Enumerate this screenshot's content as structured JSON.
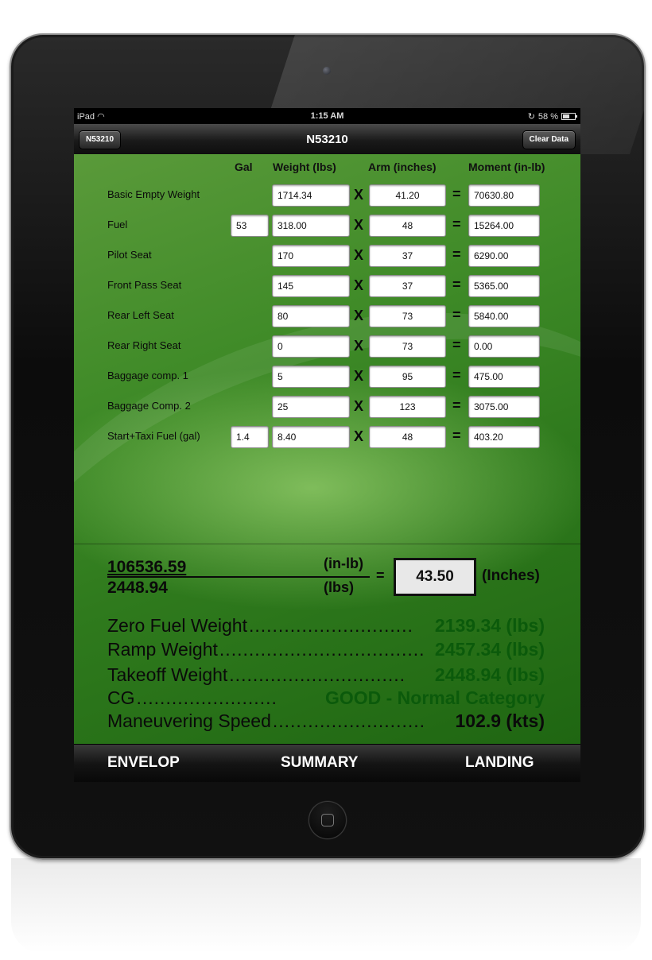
{
  "status_bar": {
    "carrier": "iPad",
    "time": "1:15 AM",
    "battery": "58 %"
  },
  "nav": {
    "back_label": "N53210",
    "title": "N53210",
    "clear_label": "Clear Data"
  },
  "columns": {
    "gal": "Gal",
    "weight": "Weight (lbs)",
    "arm": "Arm (inches)",
    "moment": "Moment (in-lb)"
  },
  "operators": {
    "times": "X",
    "equals": "="
  },
  "rows": [
    {
      "label": "Basic Empty Weight",
      "gal": null,
      "weight": "1714.34",
      "arm": "41.20",
      "moment": "70630.80"
    },
    {
      "label": "Fuel",
      "gal": "53",
      "weight": "318.00",
      "arm": "48",
      "moment": "15264.00"
    },
    {
      "label": "Pilot Seat",
      "gal": null,
      "weight": "170",
      "arm": "37",
      "moment": "6290.00"
    },
    {
      "label": "Front Pass Seat",
      "gal": null,
      "weight": "145",
      "arm": "37",
      "moment": "5365.00"
    },
    {
      "label": "Rear Left Seat",
      "gal": null,
      "weight": "80",
      "arm": "73",
      "moment": "5840.00"
    },
    {
      "label": "Rear Right Seat",
      "gal": null,
      "weight": "0",
      "arm": "73",
      "moment": "0.00"
    },
    {
      "label": "Baggage comp. 1",
      "gal": null,
      "weight": "5",
      "arm": "95",
      "moment": "475.00"
    },
    {
      "label": "Baggage Comp. 2",
      "gal": null,
      "weight": "25",
      "arm": "123",
      "moment": "3075.00"
    },
    {
      "label": "Start+Taxi Fuel (gal)",
      "gal": "1.4",
      "weight": "8.40",
      "arm": "48",
      "moment": "403.20"
    }
  ],
  "cg_calc": {
    "numerator": "106536.59",
    "numerator_unit": "(in-lb)",
    "denominator": "2448.94",
    "denominator_unit": "(lbs)",
    "equals": "=",
    "result": "43.50",
    "result_unit": "(Inches)"
  },
  "summary": [
    {
      "label": "Zero Fuel Weight",
      "dots": "............................",
      "value": "2139.34 (lbs)"
    },
    {
      "label": "Ramp Weight",
      "dots": "...................................",
      "value": "2457.34 (lbs)"
    },
    {
      "label": "Takeoff Weight",
      "dots": "..............................",
      "value": "2448.94 (lbs)"
    },
    {
      "label": "CG",
      "dots": "........................",
      "value": "GOOD - Normal Category"
    },
    {
      "label": "Maneuvering Speed",
      "dots": "..........................",
      "value": "102.9 (kts)"
    }
  ],
  "tabs": [
    "ENVELOP",
    "SUMMARY",
    "LANDING"
  ],
  "colors": {
    "background_green": "#3e8a27",
    "summary_value_green": "#0b5a0b"
  }
}
